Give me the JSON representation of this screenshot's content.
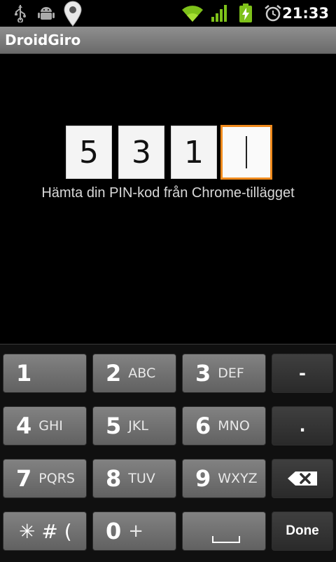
{
  "status_bar": {
    "time": "21:33",
    "icons": [
      "usb-icon",
      "android-debug-icon",
      "location-pin-icon",
      "wifi-icon",
      "signal-icon",
      "battery-charging-icon",
      "alarm-icon"
    ]
  },
  "app": {
    "title": "DroidGiro"
  },
  "pin": {
    "digits": [
      "5",
      "3",
      "1",
      ""
    ],
    "hint": "Hämta din PIN-kod från Chrome-tillägget"
  },
  "keypad": {
    "rows": [
      [
        {
          "num": "1",
          "letters": ""
        },
        {
          "num": "2",
          "letters": "ABC"
        },
        {
          "num": "3",
          "letters": "DEF"
        },
        {
          "label": "-"
        }
      ],
      [
        {
          "num": "4",
          "letters": "GHI"
        },
        {
          "num": "5",
          "letters": "JKL"
        },
        {
          "num": "6",
          "letters": "MNO"
        },
        {
          "label": "."
        }
      ],
      [
        {
          "num": "7",
          "letters": "PQRS"
        },
        {
          "num": "8",
          "letters": "TUV"
        },
        {
          "num": "9",
          "letters": "WXYZ"
        },
        {
          "label": ""
        }
      ],
      [
        {
          "sym": "✳ # ("
        },
        {
          "num": "0",
          "letters": "+"
        },
        {
          "label": ""
        },
        {
          "label": "Done"
        }
      ]
    ]
  },
  "colors": {
    "accent": "#f08a1c",
    "key_light": "#727272",
    "key_dark": "#353535"
  }
}
